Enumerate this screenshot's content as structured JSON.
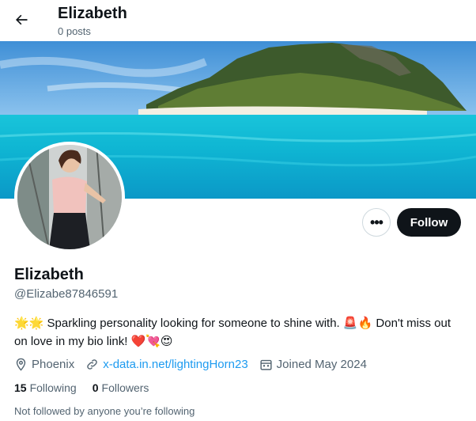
{
  "header": {
    "title": "Elizabeth",
    "post_count": "0 posts",
    "back_icon": "arrow-left-icon"
  },
  "profile": {
    "display_name": "Elizabeth",
    "handle": "@Elizabe87846591",
    "bio": {
      "lead_emojis": "🌟🌟",
      "text_1": " Sparkling personality looking for someone to shine with. ",
      "mid_emojis": "🚨🔥",
      "text_2": " Don't miss out on love in my bio link! ",
      "end_emojis": "❤️💘😍"
    },
    "location": "Phoenix",
    "website": "x-data.in.net/lightingHorn23",
    "joined": "Joined May 2024",
    "following_count": "15",
    "following_label": "Following",
    "followers_count": "0",
    "followers_label": "Followers",
    "not_followed_text": "Not followed by anyone you’re following"
  },
  "actions": {
    "more_label": "•••",
    "follow_label": "Follow"
  },
  "colors": {
    "accent_link": "#1d9bf0",
    "follow_bg": "#0f1419",
    "secondary_text": "#536471"
  }
}
